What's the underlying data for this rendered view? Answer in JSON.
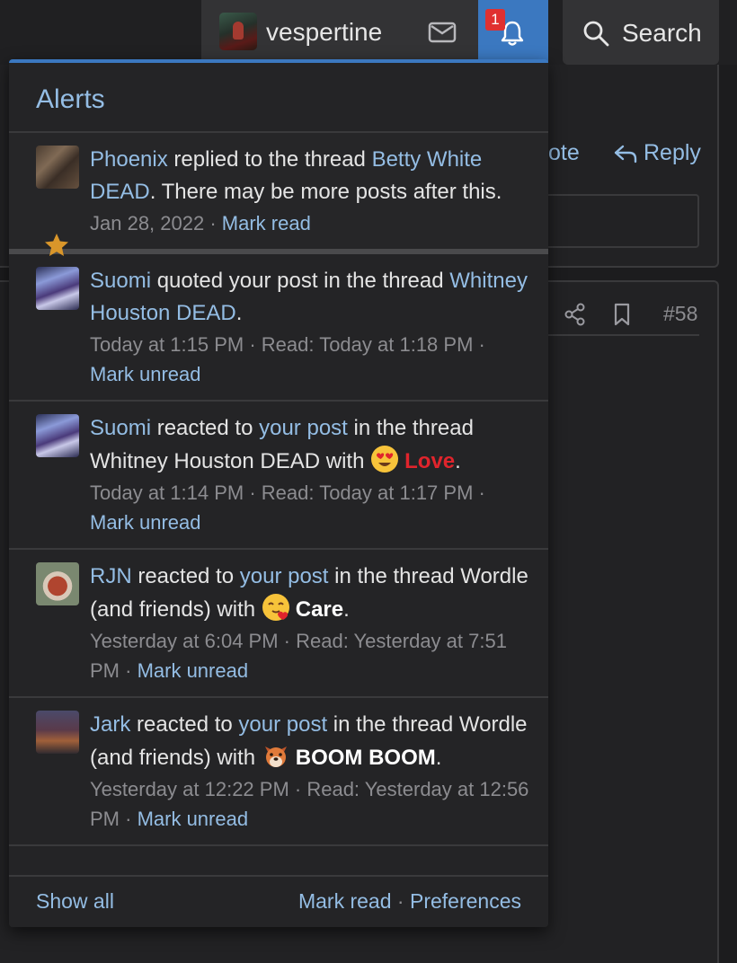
{
  "nav": {
    "username": "vespertine",
    "alert_count": "1",
    "search_label": "Search"
  },
  "background": {
    "quote_label": "ote",
    "reply_label": "Reply",
    "post_number": "#58"
  },
  "popup": {
    "title": "Alerts",
    "alerts": [
      {
        "user": "Phoenix",
        "text1": " replied to the thread ",
        "thread": "Betty White DEAD",
        "text2": ". There may be more posts after this.",
        "date": "Jan 28, 2022",
        "sep": " · ",
        "action": "Mark read"
      },
      {
        "user": "Suomi",
        "text1": " quoted your post in the thread ",
        "thread": "Whitney Houston DEAD",
        "text2": ".",
        "date": "Today at 1:15 PM",
        "read": " · Read: Today at 1:18 PM · ",
        "action": "Mark unread"
      },
      {
        "user": "Suomi",
        "text1": " reacted to ",
        "post_link": "your post",
        "text2": " in the thread Whitney Houston DEAD with ",
        "reaction": "Love",
        "end": ".",
        "date": "Today at 1:14 PM",
        "read": " · Read: Today at 1:17 PM · ",
        "action": "Mark unread"
      },
      {
        "user": "RJN",
        "text1": " reacted to ",
        "post_link": "your post",
        "text2": " in the thread Wordle (and friends) with ",
        "reaction": "Care",
        "end": ".",
        "date": "Yesterday at 6:04 PM",
        "read": " · Read: Yesterday at 7:51 PM · ",
        "action": "Mark unread"
      },
      {
        "user": "Jark",
        "text1": " reacted to ",
        "post_link": "your post",
        "text2": " in the thread Wordle (and friends) with ",
        "reaction": "BOOM BOOM",
        "end": ".",
        "date": "Yesterday at 12:22 PM",
        "read": " · Read: Yesterday at 12:56 PM · ",
        "action": "Mark unread"
      }
    ],
    "footer": {
      "show_all": "Show all",
      "mark_read": "Mark read",
      "sep": " · ",
      "preferences": "Preferences"
    }
  },
  "icons": {
    "mail": "mail-icon",
    "bell": "bell-icon",
    "search": "search-icon",
    "reply": "reply-icon",
    "share": "share-icon",
    "bookmark": "bookmark-icon",
    "star": "star-icon",
    "love": "heart-eyes-emoji",
    "care": "care-emoji",
    "boom": "dog-emoji"
  },
  "colors": {
    "accent": "#3b78c0",
    "link": "#94bde4",
    "badge": "#e03030",
    "love": "#e0242c",
    "star": "#d9962a"
  }
}
